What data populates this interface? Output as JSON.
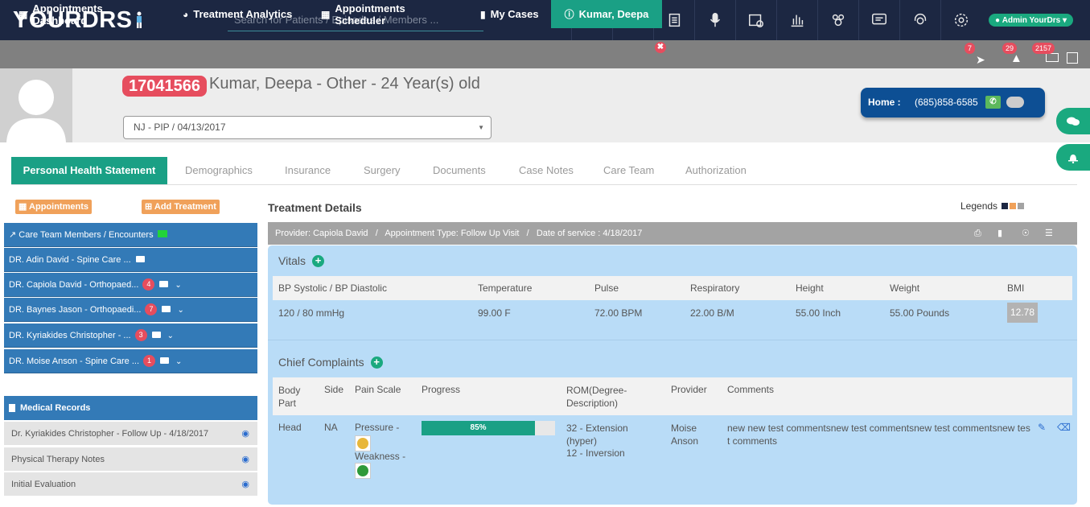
{
  "app": {
    "logo": "YOURDRS"
  },
  "search": {
    "placeholder": "Search for Patients / Episodes / Members ..."
  },
  "toolbar": {
    "icons": [
      "dashboard-gauge-icon",
      "mail-icon",
      "documents-icon",
      "microphone-icon",
      "calendar-clock-icon",
      "bar-chart-icon",
      "users-group-icon",
      "chat-icon",
      "support-headset-icon",
      "gear-icon"
    ],
    "admin_label": "Admin YourDrs"
  },
  "nav": {
    "items": [
      {
        "label": "Appointments Dashboard",
        "icon": "calendar-icon"
      },
      {
        "label": "Treatment Analytics",
        "icon": "dashboard-icon"
      },
      {
        "label": "Appointments Scheduler",
        "icon": "calendar-icon"
      },
      {
        "label": "My Cases",
        "icon": "file-icon"
      },
      {
        "label": "Kumar, Deepa",
        "icon": "info-icon"
      }
    ],
    "close_symbol": "✖",
    "badges": {
      "tags": "7",
      "bell": "29",
      "mail": "2157"
    }
  },
  "patient": {
    "id": "17041566",
    "title": "Kumar, Deepa - Other - 24 Year(s) old",
    "episode": "NJ - PIP / 04/13/2017",
    "phone_label": "Home :",
    "phone": "(685)858-6585"
  },
  "tabs": [
    "Personal Health Statement",
    "Demographics",
    "Insurance",
    "Surgery",
    "Documents",
    "Case Notes",
    "Care Team",
    "Authorization"
  ],
  "left": {
    "appointments_btn": "Appointments",
    "add_treatment_btn": "Add Treatment",
    "care_team_header": "Care Team Members / Encounters",
    "doctors": [
      {
        "name": "DR. Adin David - Spine Care ...",
        "count": ""
      },
      {
        "name": "DR. Capiola David - Orthopaed...",
        "count": "4"
      },
      {
        "name": "DR. Baynes Jason - Orthopaedi...",
        "count": "7"
      },
      {
        "name": "DR. Kyriakides Christopher - ...",
        "count": "3"
      },
      {
        "name": "DR. Moise Anson - Spine Care ...",
        "count": "1"
      }
    ],
    "medical_records_header": "Medical Records",
    "records": [
      "Dr. Kyriakides Christopher - Follow Up - 4/18/2017",
      "Physical Therapy Notes",
      "Initial Evaluation"
    ]
  },
  "treatment": {
    "title": "Treatment Details",
    "legends_label": "Legends",
    "legend_colors": [
      "#1c2742",
      "#f0a15a",
      "#a3a3a3"
    ],
    "provider_bar": "Provider: Capiola David   /   Appointment Type: Follow Up Visit   /   Date of service : 4/18/2017",
    "vitals_title": "Vitals",
    "vitals_headers": [
      "BP Systolic / BP Diastolic",
      "Temperature",
      "Pulse",
      "Respiratory",
      "Height",
      "Weight",
      "BMI"
    ],
    "vitals_values": [
      "120 / 80 mmHg",
      "99.00 F",
      "72.00 BPM",
      "22.00 B/M",
      "55.00 Inch",
      "55.00 Pounds",
      "12.78"
    ],
    "complaints_title": "Chief Complaints",
    "complaint_headers": [
      "Body Part",
      "Side",
      "Pain Scale",
      "Progress",
      "ROM(Degree-Description)",
      "Provider",
      "Comments"
    ],
    "complaint": {
      "body_part": "Head",
      "side": "NA",
      "pain1": "Pressure -",
      "pain2": "Weakness -",
      "progress_label": "85%",
      "progress": 0.85,
      "rom1": "32 - Extension (hyper)",
      "rom2": "12 - Inversion",
      "provider": "Moise Anson",
      "comments": "new new test commentsnew test commentsnew test commentsnew test comments"
    }
  }
}
